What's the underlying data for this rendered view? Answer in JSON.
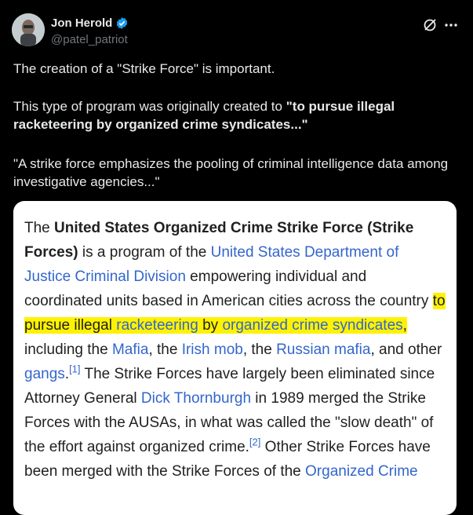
{
  "author": {
    "name": "Jon Herold",
    "handle": "@patel_patriot"
  },
  "icons": {
    "avatar": "avatar",
    "verified": "verified-badge-icon",
    "grok": "grok-icon",
    "more": "more-icon"
  },
  "colors": {
    "background": "#000000",
    "text": "#e7e9ea",
    "muted": "#71767b",
    "verified": "#1d9bf0",
    "link": "#3366cc",
    "highlight": "#fff200"
  },
  "tweet": {
    "p1": "The creation of a \"Strike Force\" is important.",
    "p2_plain": "This type of program was originally created to ",
    "p2_bold": "\"to pursue illegal racketeering by organized crime syndicates...\"",
    "p3": "\"A strike force emphasizes the pooling of criminal intelligence data among investigative agencies...\""
  },
  "wiki": {
    "t1": "The ",
    "b1": "United States Organized Crime Strike Force (Strike Forces)",
    "t2": " is a program of the ",
    "l1": "United States Department of Justice Criminal Division",
    "t3": " empowering individual and coordinated units based in American cities across the country ",
    "h1": "to pursue illegal ",
    "hl1": "racketeering",
    "h2": " by ",
    "hl2": "organized crime syndicates",
    "h3": ", ",
    "t4": "including the ",
    "l2": "Mafia",
    "t5": ", the ",
    "l3": "Irish mob",
    "t6": ", the ",
    "l4": "Russian mafia",
    "t7": ", and other ",
    "l5": "gangs",
    "t8": ".",
    "ref1": "[1]",
    "t9": " The Strike Forces have largely been eliminated since Attorney General ",
    "l6": "Dick Thornburgh",
    "t10": " in 1989 merged the Strike Forces with the AUSAs, in what was called the \"slow death\" of the effort against organized crime.",
    "ref2": "[2]",
    "t11": " Other Strike Forces have been merged with the Strike Forces of the ",
    "l7": "Organized Crime"
  }
}
